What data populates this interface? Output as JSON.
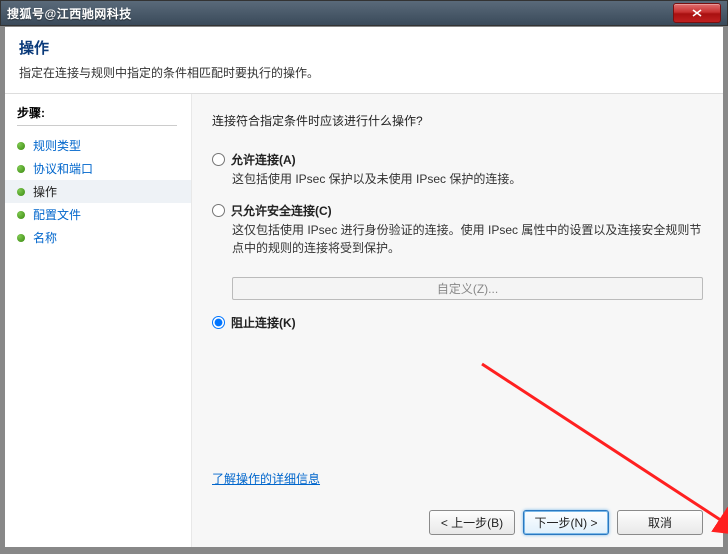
{
  "titlebar": {
    "text": "搜狐号@江西驰网科技"
  },
  "header": {
    "title": "操作",
    "subtitle": "指定在连接与规则中指定的条件相匹配时要执行的操作。"
  },
  "sidebar": {
    "heading": "步骤:",
    "items": [
      {
        "label": "规则类型"
      },
      {
        "label": "协议和端口"
      },
      {
        "label": "操作"
      },
      {
        "label": "配置文件"
      },
      {
        "label": "名称"
      }
    ]
  },
  "content": {
    "question": "连接符合指定条件时应该进行什么操作?",
    "options": [
      {
        "label": "允许连接(A)",
        "desc": "这包括使用 IPsec 保护以及未使用 IPsec 保护的连接。"
      },
      {
        "label": "只允许安全连接(C)",
        "desc": "这仅包括使用 IPsec 进行身份验证的连接。使用 IPsec 属性中的设置以及连接安全规则节点中的规则的连接将受到保护。"
      },
      {
        "label": "阻止连接(K)"
      }
    ],
    "customize_btn": "自定义(Z)...",
    "more_link": "了解操作的详细信息"
  },
  "footer": {
    "back": "< 上一步(B)",
    "next": "下一步(N) >",
    "cancel": "取消"
  }
}
